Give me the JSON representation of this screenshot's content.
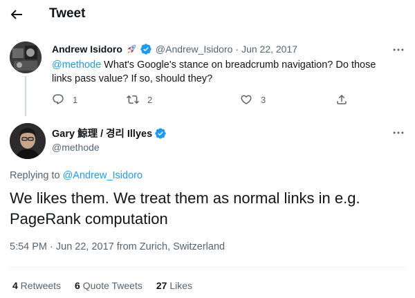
{
  "header": {
    "title": "Tweet",
    "back_icon": "arrow-left-icon"
  },
  "reply_tweet": {
    "author_name": "Andrew Isidoro",
    "emoji": "rocket",
    "handle": "@Andrew_Isidoro",
    "separator": "·",
    "date": "Jun 22, 2017",
    "mention": "@methode",
    "text": " What's Google's stance on breadcrumb navigation? Do those links pass value? If so, should they?",
    "reply_count": "1",
    "retweet_count": "2",
    "like_count": "3"
  },
  "main_tweet": {
    "author_name": "Gary 鯨理 / 경리 Illyes",
    "handle": "@methode",
    "replying_prefix": "Replying to ",
    "replying_to": "@Andrew_Isidoro",
    "text": "We likes them. We treat them as normal links in e.g. PageRank computation",
    "timestamp": "5:54 PM · Jun 22, 2017 from Zurich, Switzerland",
    "stats": [
      {
        "count": "4",
        "label": " Retweets"
      },
      {
        "count": "6",
        "label": " Quote Tweets"
      },
      {
        "count": "27",
        "label": " Likes"
      }
    ]
  },
  "colors": {
    "accent": "#1d9bf0",
    "secondary_text": "#536471",
    "primary_text": "#0f1419"
  }
}
